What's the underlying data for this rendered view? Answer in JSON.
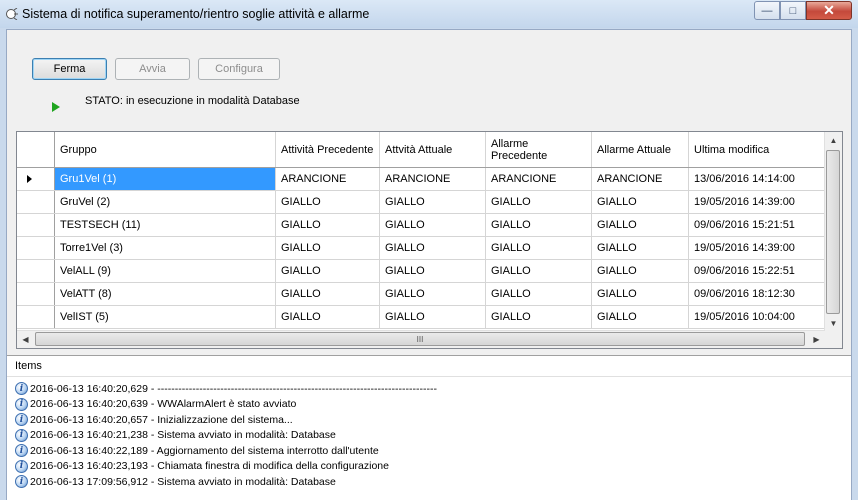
{
  "window": {
    "title": "Sistema di notifica superamento/rientro soglie attività e allarme"
  },
  "caption": {
    "minimize": "—",
    "maximize": "□",
    "close": "✕"
  },
  "toolbar": {
    "stop_label": "Ferma",
    "start_label": "Avvia",
    "config_label": "Configura"
  },
  "status": {
    "text": "STATO: in esecuzione in modalità Database",
    "indicator_color": "#1fa51f"
  },
  "grid": {
    "columns": [
      "Gruppo",
      "Attività Precedente",
      "Attvità Attuale",
      "Allarme Precedente",
      "Allarme Attuale",
      "Ultima modifica"
    ],
    "rows": [
      [
        "Gru1Vel (1)",
        "ARANCIONE",
        "ARANCIONE",
        "ARANCIONE",
        "ARANCIONE",
        "13/06/2016 14:14:00"
      ],
      [
        "GruVel (2)",
        "GIALLO",
        "GIALLO",
        "GIALLO",
        "GIALLO",
        "19/05/2016 14:39:00"
      ],
      [
        "TESTSECH (11)",
        "GIALLO",
        "GIALLO",
        "GIALLO",
        "GIALLO",
        "09/06/2016 15:21:51"
      ],
      [
        "Torre1Vel (3)",
        "GIALLO",
        "GIALLO",
        "GIALLO",
        "GIALLO",
        "19/05/2016 14:39:00"
      ],
      [
        "VelALL (9)",
        "GIALLO",
        "GIALLO",
        "GIALLO",
        "GIALLO",
        "09/06/2016 15:22:51"
      ],
      [
        "VelATT (8)",
        "GIALLO",
        "GIALLO",
        "GIALLO",
        "GIALLO",
        "09/06/2016 18:12:30"
      ],
      [
        "VelIST (5)",
        "GIALLO",
        "GIALLO",
        "GIALLO",
        "GIALLO",
        "19/05/2016 10:04:00"
      ]
    ],
    "selected_row": 0,
    "selection_color": "#3399ff",
    "hscroll_grip": "III"
  },
  "log": {
    "header": "Items",
    "icon": "i",
    "items": [
      "2016-06-13 16:40:20,629 - --------------------------------------------------------------------------------",
      "2016-06-13 16:40:20,639 - WWAlarmAlert è stato avviato",
      "2016-06-13 16:40:20,657 - Inizializzazione del sistema...",
      "2016-06-13 16:40:21,238 - Sistema avviato in modalità: Database",
      "2016-06-13 16:40:22,189 - Aggiornamento del sistema interrotto dall'utente",
      "2016-06-13 16:40:23,193 - Chiamata finestra di modifica della configurazione",
      "2016-06-13 17:09:56,912 - Sistema avviato in modalità: Database"
    ]
  }
}
